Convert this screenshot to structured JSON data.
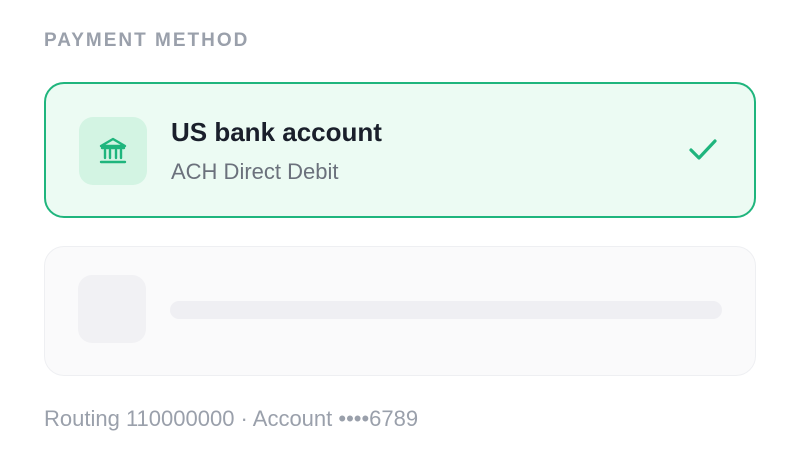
{
  "payment": {
    "section_label": "PAYMENT METHOD",
    "selected_option": {
      "icon": "bank-icon",
      "title": "US bank account",
      "subtitle": "ACH Direct Debit",
      "selected": true
    },
    "footer_note": "Routing 110000000 · Account ••••6789"
  },
  "colors": {
    "accent": "#1fb57d",
    "selected_background": "#ecfbf3",
    "icon_tile": "#d3f4e3",
    "title_text": "#1a1f2b",
    "muted_text": "#9aa0ab"
  }
}
